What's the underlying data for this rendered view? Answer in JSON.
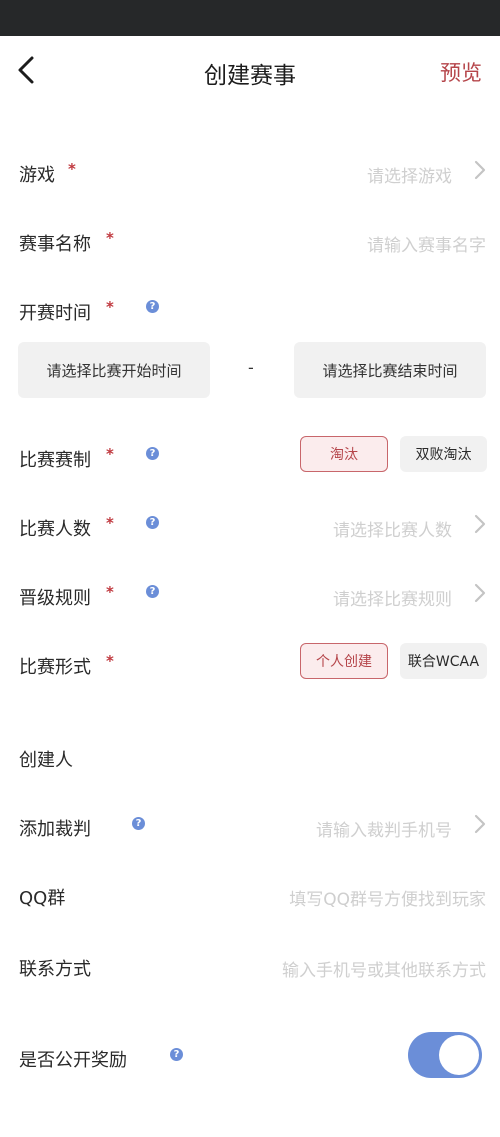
{
  "header": {
    "title": "创建赛事",
    "preview_label": "预览"
  },
  "form": {
    "game": {
      "label": "游戏",
      "placeholder": "请选择游戏"
    },
    "event_name": {
      "label": "赛事名称",
      "placeholder": "请输入赛事名字"
    },
    "start_time": {
      "label": "开赛时间",
      "start_label": "请选择比赛开始时间",
      "separator": "-",
      "end_label": "请选择比赛结束时间"
    },
    "format": {
      "label": "比赛赛制",
      "options": [
        "淘汰",
        "双败淘汰"
      ],
      "selected": "淘汰"
    },
    "player_count": {
      "label": "比赛人数",
      "placeholder": "请选择比赛人数"
    },
    "advance_rule": {
      "label": "晋级规则",
      "placeholder": "请选择比赛规则"
    },
    "mode": {
      "label": "比赛形式",
      "options": [
        "个人创建",
        "联合WCAA"
      ],
      "selected": "个人创建"
    },
    "creator": {
      "label": "创建人"
    },
    "referee": {
      "label": "添加裁判",
      "placeholder": "请输入裁判手机号"
    },
    "qq_group": {
      "label": "QQ群",
      "placeholder": "填写QQ群号方便找到玩家"
    },
    "contact": {
      "label": "联系方式",
      "placeholder": "输入手机号或其他联系方式"
    },
    "public_reward": {
      "label": "是否公开奖励",
      "enabled": true
    }
  },
  "symbols": {
    "required": "*",
    "help": "?"
  },
  "colors": {
    "accent": "#b5454a",
    "toggle": "#6b8ed8",
    "placeholder": "#cfcfcf",
    "status_bar": "#262829"
  },
  "icons": [
    "back-arrow-icon",
    "chevron-right-icon",
    "help-icon"
  ]
}
